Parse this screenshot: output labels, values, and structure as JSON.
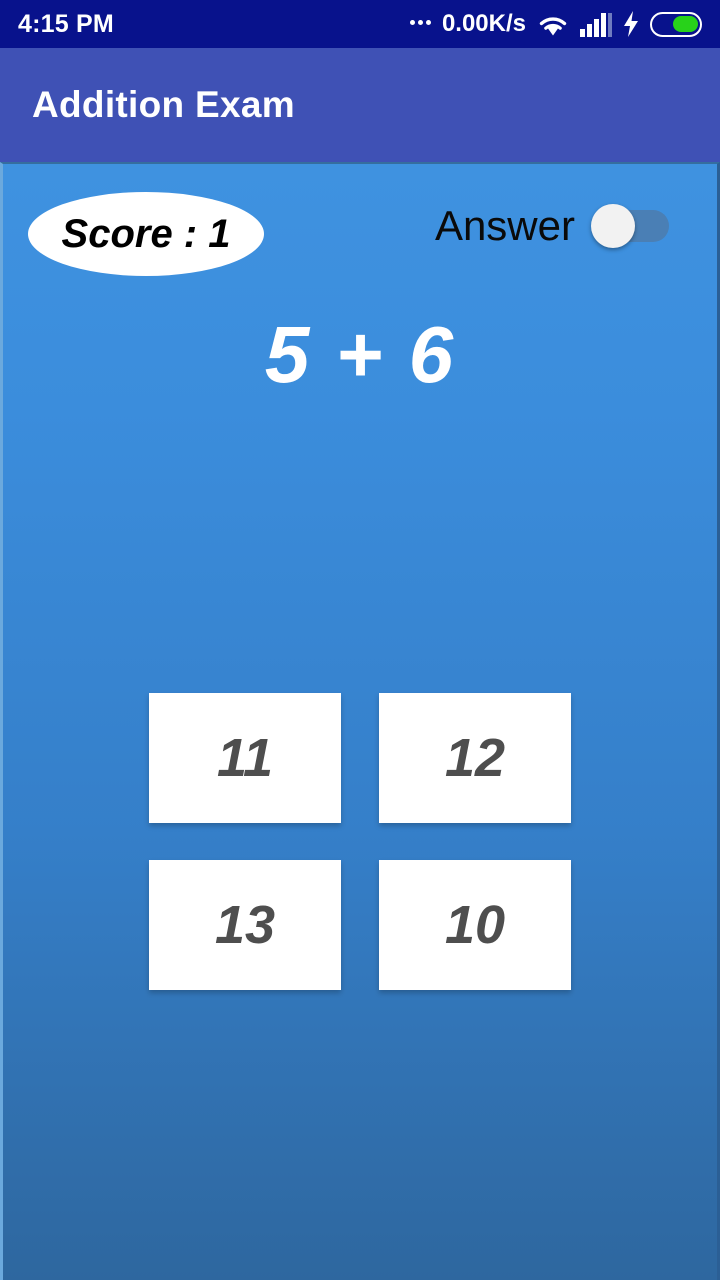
{
  "status_bar": {
    "clock": "4:15 PM",
    "network_speed": "0.00K/s",
    "icons": {
      "more": "more-dots-icon",
      "wifi": "wifi-icon",
      "signal": "signal-bars-icon",
      "charging": "charging-bolt-icon",
      "battery": "battery-icon"
    },
    "colors": {
      "background": "#08128c",
      "battery_fill": "#28d21a",
      "foreground": "#ffffff"
    }
  },
  "app_bar": {
    "title": "Addition Exam",
    "background": "#3f51b5",
    "text_color": "#ffffff"
  },
  "main": {
    "score": {
      "label": "Score : 1",
      "text_color": "#000000",
      "background": "#ffffff"
    },
    "answer_toggle": {
      "label": "Answer",
      "state": "off",
      "track_color": "#4a7fb5",
      "thumb_color": "#f2f2f2"
    },
    "question": {
      "text": "5 + 6",
      "left_operand": "5",
      "operator": "+",
      "right_operand": "6",
      "text_color": "#ffffff"
    },
    "options": [
      {
        "label": "11"
      },
      {
        "label": "12"
      },
      {
        "label": "13"
      },
      {
        "label": "10"
      }
    ],
    "option_text_color": "#4e4e4e",
    "option_background": "#ffffff",
    "background_top_color": "#3f92e0",
    "background_bottom_color": "#2e679f"
  }
}
